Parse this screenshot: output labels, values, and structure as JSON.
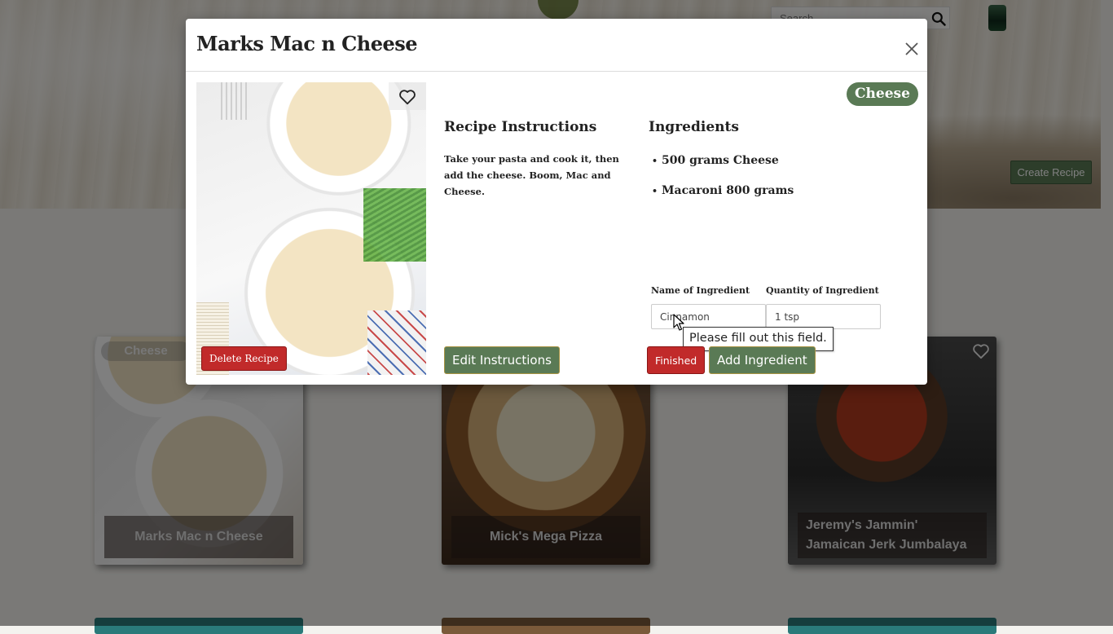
{
  "header": {
    "search_placeholder": "Search",
    "search_icon": "search-icon",
    "avatar_icon": "avatar",
    "create_recipe_label": "Create Recipe"
  },
  "cards": [
    {
      "tag": "Cheese",
      "title": "Marks Mac n Cheese",
      "favorite_icon": "heart-outline-icon"
    },
    {
      "tag": "",
      "title": "Mick's Mega Pizza",
      "favorite_icon": ""
    },
    {
      "tag": "",
      "title": "Jeremy's Jammin' Jamaican Jerk Jumbalaya",
      "favorite_icon": "heart-outline-icon"
    }
  ],
  "modal": {
    "title": "Marks Mac n Cheese",
    "close_icon": "close-icon",
    "favorite_icon": "heart-outline-icon",
    "tag": "Cheese",
    "delete_label": "Delete Recipe",
    "instructions": {
      "heading": "Recipe Instructions",
      "text": "Take your pasta and cook it, then add the cheese. Boom, Mac and Cheese.",
      "edit_label": "Edit Instructions"
    },
    "ingredients": {
      "heading": "Ingredients",
      "items": [
        {
          "bullet": "•",
          "text": "500 grams Cheese"
        },
        {
          "bullet": "•",
          "text": "Macaroni 800 grams"
        }
      ],
      "name_label": "Name of Ingredient",
      "name_value": "Cinnamon",
      "quantity_label": "Quantity of Ingredient",
      "quantity_value": "1 tsp",
      "validation_message": "Please fill out this field.",
      "finished_label": "Finished",
      "add_label": "Add Ingredient"
    }
  },
  "colors": {
    "accent_green": "#5a7a55",
    "danger_red": "#c12a2a"
  }
}
